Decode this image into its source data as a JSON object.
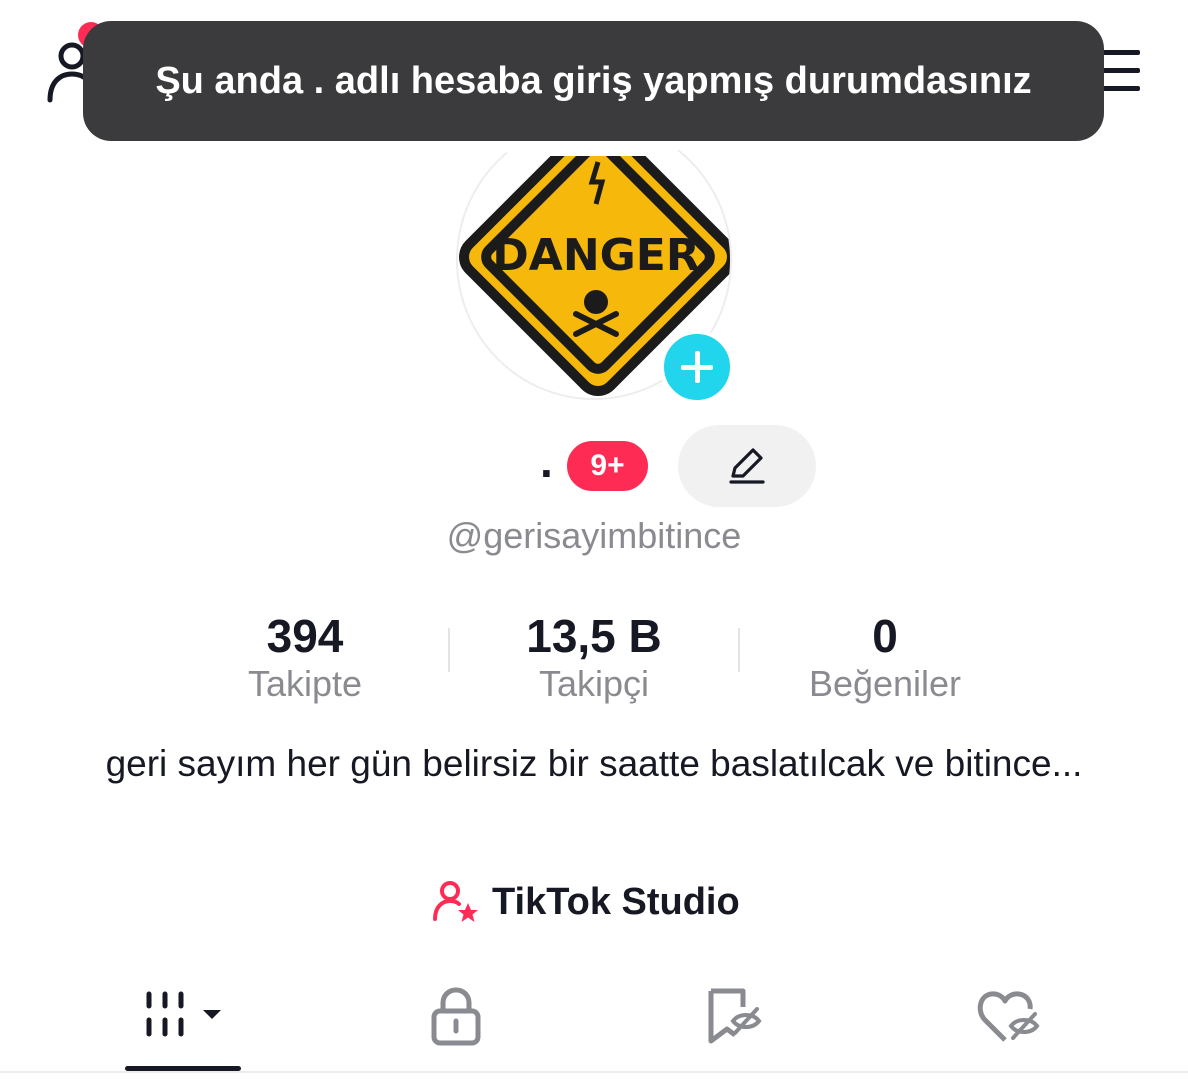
{
  "toast": {
    "message": "Şu anda . adlı hesaba giriş yapmış durumdasınız"
  },
  "header": {
    "add_friend_icon": "person-add-icon",
    "menu_icon": "hamburger-menu-icon"
  },
  "profile": {
    "avatar_text": "DANGER",
    "display_name": ".",
    "notification_badge": "9+",
    "username": "@gerisayimbitince",
    "edit_icon": "pencil-icon"
  },
  "stats": [
    {
      "value": "394",
      "label": "Takipte"
    },
    {
      "value": "13,5 B",
      "label": "Takipçi"
    },
    {
      "value": "0",
      "label": "Beğeniler"
    }
  ],
  "bio": "geri sayım her gün belirsiz bir saatte baslatılcak ve bitince...",
  "studio": {
    "label": "TikTok Studio",
    "icon": "creator-star-icon"
  },
  "tabs": [
    {
      "name": "videos-grid",
      "icon": "grid-icon"
    },
    {
      "name": "private",
      "icon": "lock-icon"
    },
    {
      "name": "favorites",
      "icon": "bookmark-hidden-icon"
    },
    {
      "name": "liked",
      "icon": "heart-hidden-icon"
    }
  ],
  "colors": {
    "accent_red": "#fe2c55",
    "accent_cyan": "#20d5ec",
    "toast_bg": "#3b3b3d",
    "secondary_text": "#8a8b91"
  }
}
